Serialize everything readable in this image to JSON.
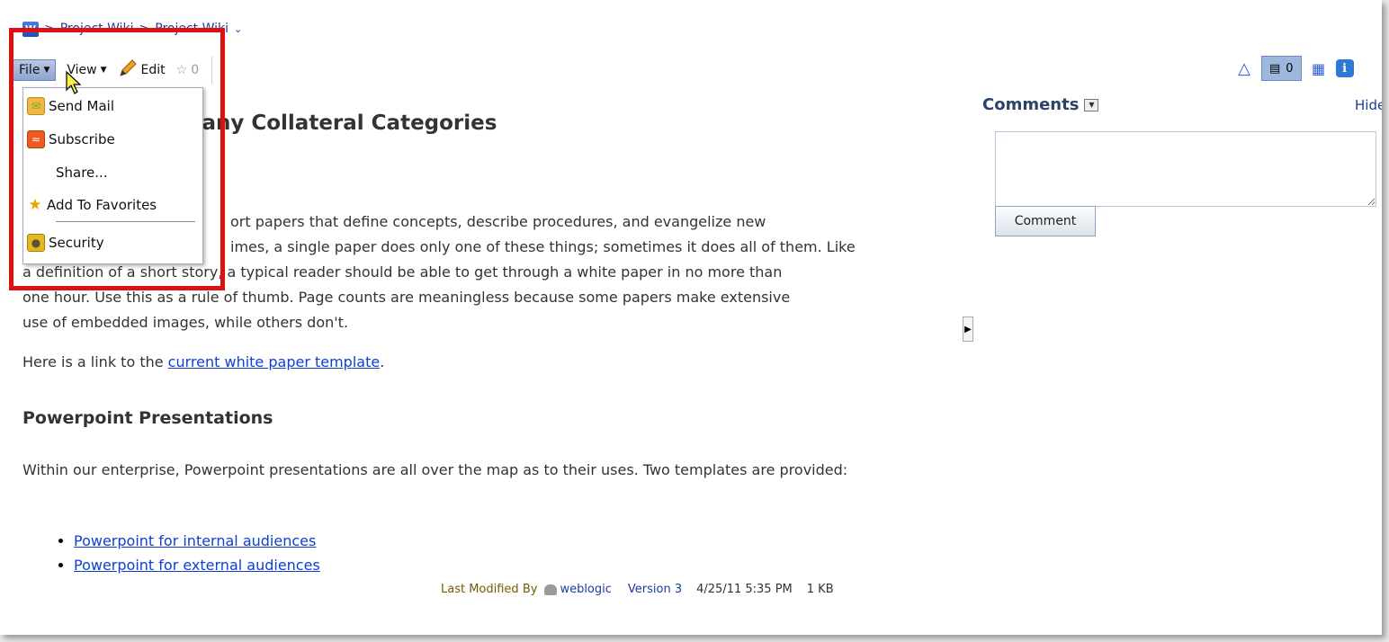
{
  "breadcrumb": {
    "sep1": ">",
    "item1": "Project Wiki",
    "sep2": ">",
    "item2": "Project Wiki"
  },
  "toolbar": {
    "file_label": "File",
    "view_label": "View",
    "edit_label": "Edit",
    "rating_count": "0"
  },
  "right_toolbar": {
    "comments_count": "0"
  },
  "file_menu": {
    "items": [
      {
        "label": "Send Mail",
        "icon": "mail-icon"
      },
      {
        "label": "Subscribe",
        "icon": "rss-icon"
      },
      {
        "label": "Share...",
        "icon": ""
      },
      {
        "label": "Add To Favorites",
        "icon": "star-add-icon"
      },
      {
        "label": "Security",
        "icon": "lock-icon"
      }
    ]
  },
  "page": {
    "title": "pany Collateral Categories",
    "para1_line1": "ort papers that define concepts, describe procedures, and evangelize new",
    "para1_line2": "imes, a single paper does only one of these things; sometimes it does all of them. Like",
    "para1_line3": "a definition of a short story, a typical reader should be able to get through a white paper in no more than",
    "para1_line4": "one hour. Use this as a rule of thumb. Page counts are meaningless because some papers make extensive",
    "para1_line5": "use of embedded images, while others don't.",
    "para2_prefix": "Here is a link to the ",
    "para2_link": "current white paper template",
    "para2_suffix": ".",
    "heading2": "Powerpoint Presentations",
    "para3": "Within our enterprise, Powerpoint presentations are all over the map as to their uses. Two templates are provided:",
    "links": [
      "Powerpoint for internal audiences",
      "Powerpoint for external audiences"
    ]
  },
  "footer": {
    "last_modified_label": "Last Modified By",
    "user": "weblogic",
    "version": "Version 3",
    "date": "4/25/11 5:35 PM",
    "size": "1 KB"
  },
  "comments": {
    "title": "Comments",
    "hide": "Hide",
    "button": "Comment"
  },
  "colors": {
    "highlight": "#e01010",
    "link": "#0d3fd6",
    "heading": "#2b4466"
  }
}
